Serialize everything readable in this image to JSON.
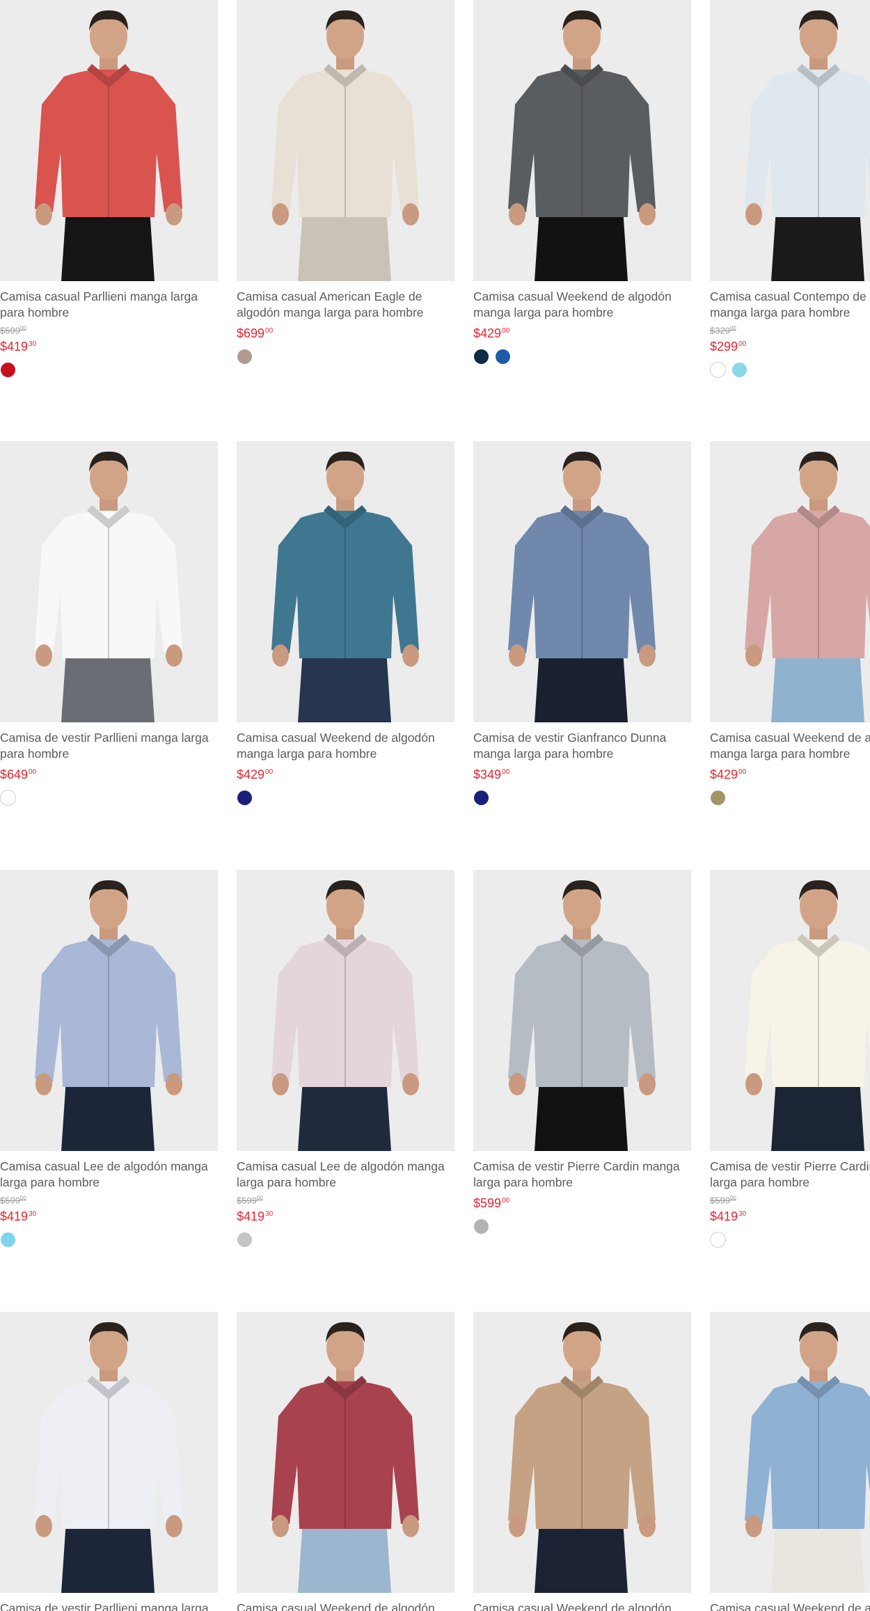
{
  "products": [
    {
      "name": "Camisa casual Parllieni manga larga para hombre",
      "old_price": "$599",
      "old_cents": "00",
      "price": "$419",
      "cents": "30",
      "shirt_color": "#d9534f",
      "pants_color": "#151515",
      "swatches": [
        "#c8101e"
      ]
    },
    {
      "name": "Camisa casual American Eagle de algodón manga larga para hombre",
      "old_price": "",
      "old_cents": "",
      "price": "$699",
      "cents": "00",
      "shirt_color": "#e8e0d4",
      "pants_color": "#c9c2b6",
      "swatches": [
        "#b19a8e"
      ]
    },
    {
      "name": "Camisa casual Weekend de algodón manga larga para hombre",
      "old_price": "",
      "old_cents": "",
      "price": "$429",
      "cents": "00",
      "shirt_color": "#5a5d60",
      "pants_color": "#121212",
      "swatches": [
        "#0d2b45",
        "#1f5ca8"
      ]
    },
    {
      "name": "Camisa casual Contempo de algodón manga larga para hombre",
      "old_price": "$329",
      "old_cents": "00",
      "price": "$299",
      "cents": "00",
      "shirt_color": "#dfe8ef",
      "pants_color": "#1a1a1a",
      "swatches": [
        "#ffffff",
        "#8ad8ea"
      ]
    },
    {
      "name": "Camisa de vestir Parllieni manga larga para hombre",
      "old_price": "",
      "old_cents": "",
      "price": "$649",
      "cents": "00",
      "shirt_color": "#f8f8f8",
      "pants_color": "#6a6e74",
      "swatches": [
        "#ffffff"
      ]
    },
    {
      "name": "Camisa casual Weekend de algodón manga larga para hombre",
      "old_price": "",
      "old_cents": "",
      "price": "$429",
      "cents": "00",
      "shirt_color": "#3f7790",
      "pants_color": "#26364f",
      "swatches": [
        "#1a1f7a"
      ]
    },
    {
      "name": "Camisa de vestir Gianfranco Dunna manga larga para hombre",
      "old_price": "",
      "old_cents": "",
      "price": "$349",
      "cents": "00",
      "shirt_color": "#7188ad",
      "pants_color": "#1a2030",
      "swatches": [
        "#1a1f7a"
      ]
    },
    {
      "name": "Camisa casual Weekend de algodón manga larga para hombre",
      "old_price": "",
      "old_cents": "",
      "price": "$429",
      "cents": "00",
      "shirt_color": "#d7a7a6",
      "pants_color": "#8fb2cf",
      "swatches": [
        "#a39465"
      ]
    },
    {
      "name": "Camisa casual Lee de algodón manga larga para hombre",
      "old_price": "$599",
      "old_cents": "00",
      "price": "$419",
      "cents": "30",
      "shirt_color": "#a9b8d6",
      "pants_color": "#1d2638",
      "swatches": [
        "#7fd6ea"
      ]
    },
    {
      "name": "Camisa casual Lee de algodón manga larga para hombre",
      "old_price": "$599",
      "old_cents": "00",
      "price": "$419",
      "cents": "30",
      "shirt_color": "#e4d5dc",
      "pants_color": "#1f2a3d",
      "swatches": [
        "#c4c4c4"
      ]
    },
    {
      "name": "Camisa de vestir Pierre Cardin manga larga para hombre",
      "old_price": "",
      "old_cents": "",
      "price": "$599",
      "cents": "00",
      "shirt_color": "#b6bcc4",
      "pants_color": "#111111",
      "swatches": [
        "#b3b3b3"
      ]
    },
    {
      "name": "Camisa de vestir Pierre Cardin manga larga para hombre",
      "old_price": "$599",
      "old_cents": "00",
      "price": "$419",
      "cents": "30",
      "shirt_color": "#f7f3e6",
      "pants_color": "#1c2535",
      "swatches": [
        "#ffffff"
      ]
    },
    {
      "name": "Camisa de vestir Parllieni manga larga",
      "old_price": "",
      "old_cents": "",
      "price": "",
      "cents": "",
      "shirt_color": "#eeeff5",
      "pants_color": "#1c2638",
      "swatches": []
    },
    {
      "name": "Camisa casual Weekend de algodón",
      "old_price": "",
      "old_cents": "",
      "price": "",
      "cents": "",
      "shirt_color": "#a8424e",
      "pants_color": "#9cb6cf",
      "swatches": []
    },
    {
      "name": "Camisa casual Weekend de algodón",
      "old_price": "",
      "old_cents": "",
      "price": "",
      "cents": "",
      "shirt_color": "#c4a283",
      "pants_color": "#1b2233",
      "swatches": []
    },
    {
      "name": "Camisa casual Weekend de algodón",
      "old_price": "",
      "old_cents": "",
      "price": "",
      "cents": "",
      "shirt_color": "#8fb1d3",
      "pants_color": "#e9e6e0",
      "swatches": []
    }
  ]
}
